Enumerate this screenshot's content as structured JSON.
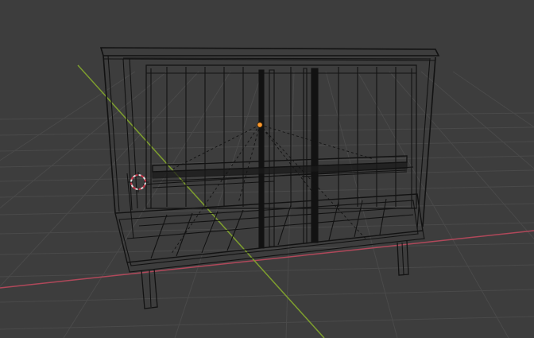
{
  "viewport": {
    "background": "#3d3d3d",
    "grid_color": "#4a4a4a",
    "x_axis_color": "#b0485a",
    "y_axis_color": "#7e9f2e",
    "wire_color": "#121212",
    "origin_color": "#ff9a2e",
    "cursor_colors": [
      "#e0e0e0",
      "#c8364a"
    ]
  },
  "scene": {
    "object": "cabinet-wireframe",
    "mode": "wireframe"
  }
}
